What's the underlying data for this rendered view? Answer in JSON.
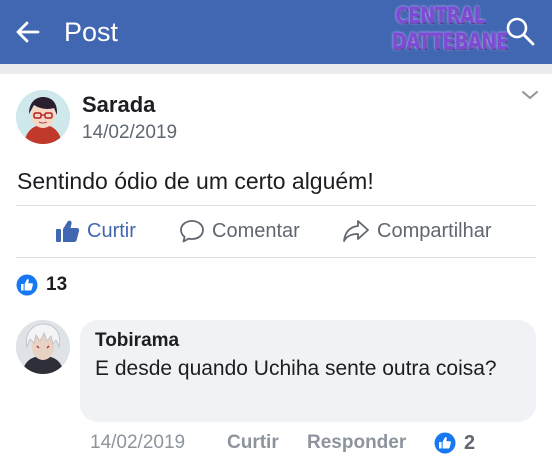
{
  "header": {
    "title": "Post",
    "watermark_line1": "CENTRAL",
    "watermark_line2": "DATTEBANE",
    "back_icon": "back-arrow-icon",
    "search_icon": "search-icon"
  },
  "post": {
    "author": "Sarada",
    "date": "14/02/2019",
    "text": "Sentindo ódio de um certo alguém!",
    "actions": {
      "like": "Curtir",
      "comment": "Comentar",
      "share": "Compartilhar"
    },
    "like_count": "13"
  },
  "comment": {
    "author": "Tobirama",
    "text": "E desde quando Uchiha sente outra coisa?",
    "date": "14/02/2019",
    "like": "Curtir",
    "reply": "Responder",
    "reaction_count": "2"
  },
  "colors": {
    "brand": "#4267b2",
    "like_blue": "#1877f2",
    "muted": "#606770"
  }
}
